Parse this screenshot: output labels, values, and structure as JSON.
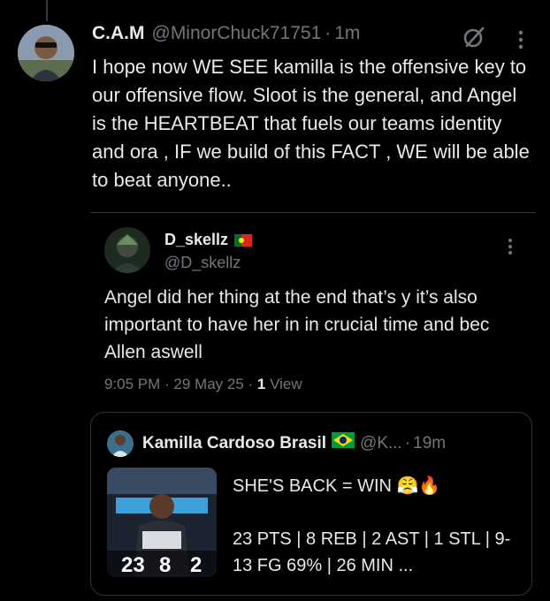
{
  "tweet": {
    "author_name": "C.A.M",
    "handle": "@MinorChuck71751",
    "separator": "·",
    "time": "1m",
    "text": "I hope now WE SEE kamilla is the offensive key to our offensive flow. Sloot is the general, and Angel is the HEARTBEAT that fuels our teams identity and ora , IF we build of this FACT ,  WE will be able to beat  anyone..",
    "icons": [
      "grok-icon",
      "more-icon"
    ]
  },
  "quoted_tweet": {
    "author_name": "D_skellz",
    "handle": "@D_skellz",
    "text": "Angel did her thing at the end that’s y it’s also important to have her in in crucial time and bec Allen aswell",
    "timestamp": "9:05 PM · 29 May 25 · ",
    "views_count": "1",
    "views_label": " View"
  },
  "nested_quote": {
    "author_name": "Kamilla Cardoso Brasil",
    "handle": "@K...",
    "separator": "·",
    "time": "19m",
    "headline": "SHE'S BACK = WIN 😤🔥",
    "stats_line": "23 PTS | 8 REB | 2 AST | 1 STL | 9-13 FG 69% | 26 MIN ...",
    "thumbnail_numbers": [
      "23",
      "8",
      "2"
    ]
  },
  "colors": {
    "background": "#000000",
    "text_primary": "#e7e9ea",
    "text_secondary": "#71767b",
    "border": "#2f3336"
  }
}
